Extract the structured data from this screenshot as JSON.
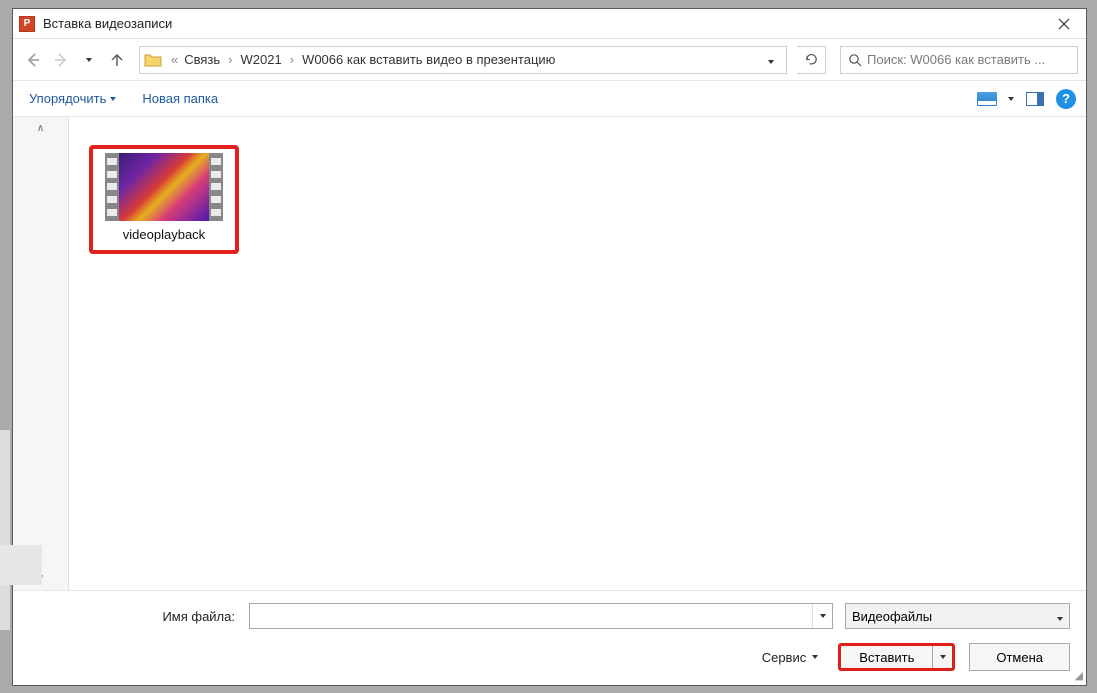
{
  "title": "Вставка видеозаписи",
  "breadcrumb": {
    "prefix": "«",
    "seg1": "Связь",
    "seg2": "W2021",
    "seg3": "W0066 как вставить видео в презентацию"
  },
  "search": {
    "placeholder": "Поиск: W0066 как вставить ..."
  },
  "toolbar": {
    "organize": "Упорядочить",
    "new_folder": "Новая папка"
  },
  "files": [
    {
      "name": "videoplayback"
    }
  ],
  "footer": {
    "filename_label": "Имя файла:",
    "filename_value": "",
    "filter_label": "Видеофайлы",
    "service_label": "Сервис",
    "insert_label": "Вставить",
    "cancel_label": "Отмена"
  }
}
